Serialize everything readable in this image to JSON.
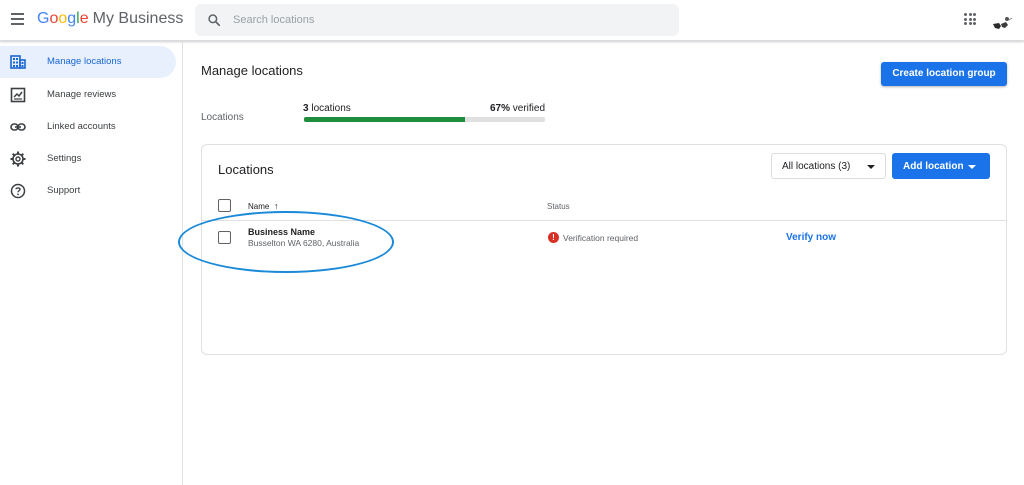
{
  "header": {
    "logo": {
      "g1": "G",
      "g2": "o",
      "g3": "o",
      "g4": "g",
      "g5": "l",
      "g6": "e",
      "product": "My Business"
    },
    "search_placeholder": "Search locations",
    "icons": {
      "menu": "menu-icon",
      "search": "search-icon",
      "apps": "apps-grid-icon",
      "account": "avatar"
    }
  },
  "sidebar": {
    "items": [
      {
        "label": "Manage locations",
        "icon": "building-icon",
        "active": true
      },
      {
        "label": "Manage reviews",
        "icon": "review-icon",
        "active": false
      },
      {
        "label": "Linked accounts",
        "icon": "link-icon",
        "active": false
      },
      {
        "label": "Settings",
        "icon": "gear-icon",
        "active": false
      },
      {
        "label": "Support",
        "icon": "help-icon",
        "active": false
      }
    ]
  },
  "main": {
    "title": "Manage locations",
    "create_group_label": "Create location group",
    "summary": {
      "label": "Locations",
      "count_num": "3",
      "count_text": " locations",
      "verified_pct": "67%",
      "verified_text": " verified",
      "progress_fraction": 0.67
    },
    "card": {
      "title": "Locations",
      "filter_label": "All locations (3)",
      "add_label": "Add location",
      "columns": {
        "name": "Name",
        "sort_arrow": "↑",
        "status": "Status"
      },
      "rows": [
        {
          "name": "Business Name",
          "address": "Busselton WA 6280, Australia",
          "status": "Verification required",
          "action": "Verify now"
        }
      ]
    }
  },
  "colors": {
    "accent": "#1a73e8",
    "active_nav_bg": "#e8f0fe",
    "progress_fill": "#1e8e3e",
    "error": "#d93025",
    "annotation": "#1a8ad8"
  }
}
